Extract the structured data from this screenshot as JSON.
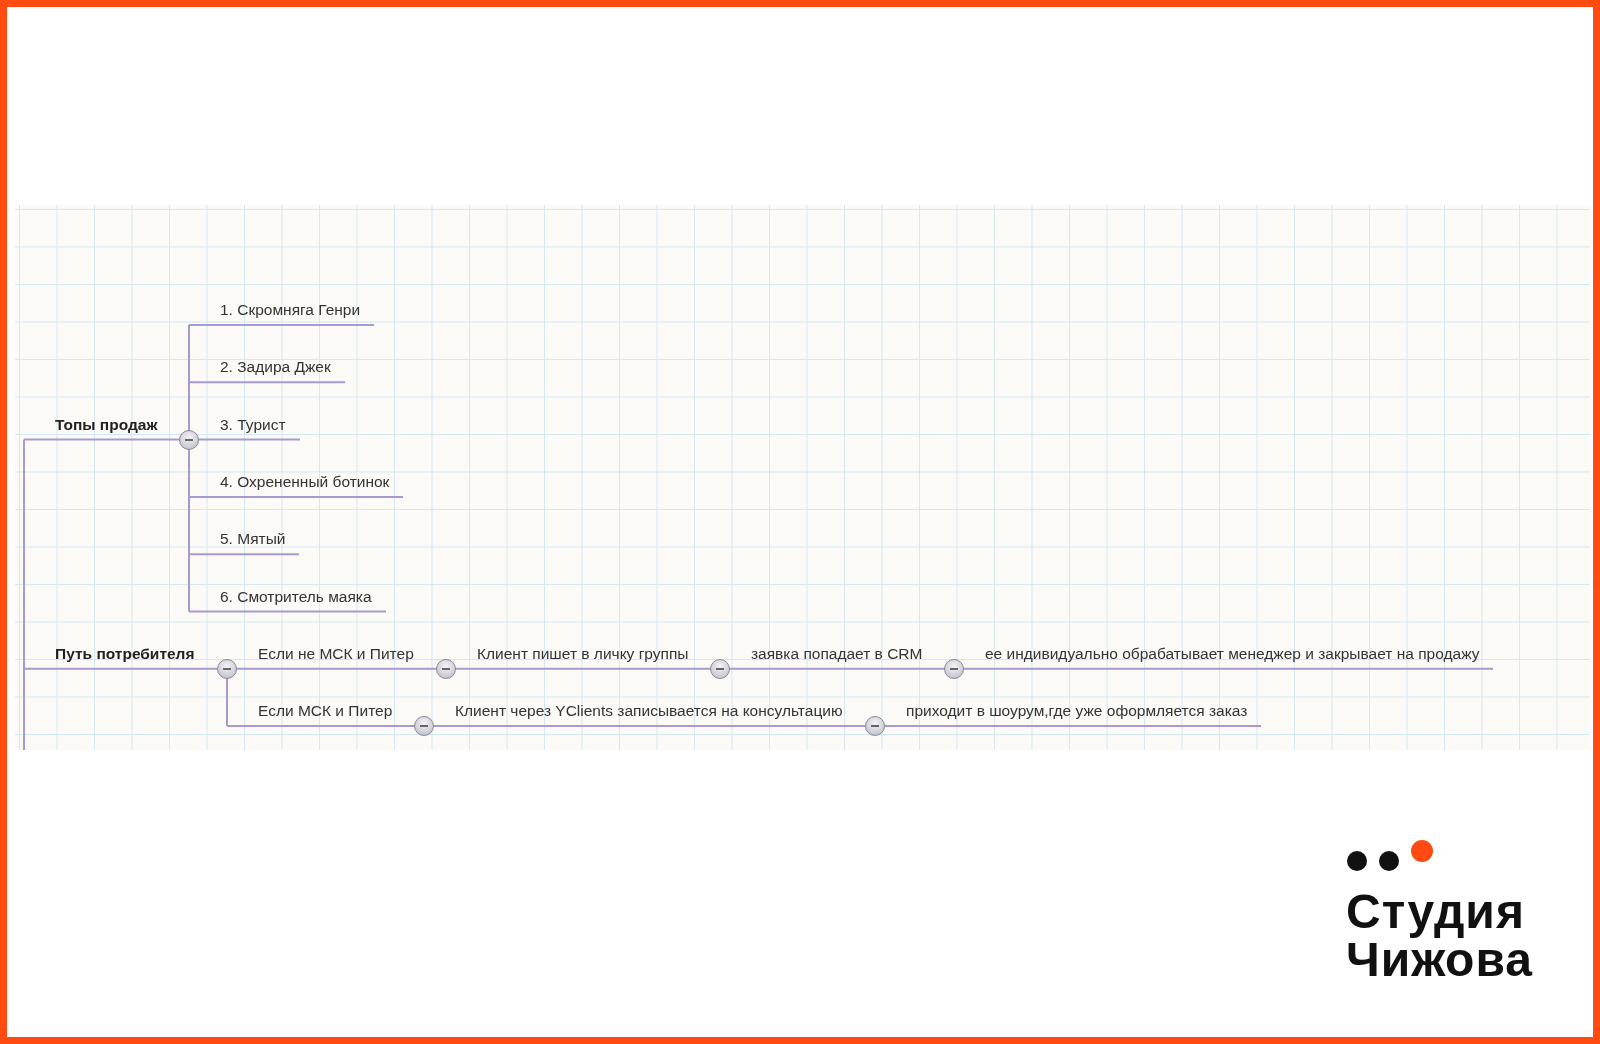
{
  "mindmap": {
    "branches": [
      {
        "text": "Топы продаж",
        "expanded": true,
        "children": [
          {
            "text": "1. Скромняга Генри"
          },
          {
            "text": "2. Задира Джек"
          },
          {
            "text": "3. Турист"
          },
          {
            "text": "4. Охрененный ботинок"
          },
          {
            "text": "5. Мятый"
          },
          {
            "text": "6. Смотритель маяка"
          }
        ]
      },
      {
        "text": "Путь потребителя",
        "expanded": true,
        "children": [
          {
            "text": "Если не МСК и Питер",
            "expanded": true,
            "children": [
              {
                "text": "Клиент пишет в личку группы",
                "expanded": true,
                "children": [
                  {
                    "text": "заявка попадает в CRM",
                    "expanded": true,
                    "children": [
                      {
                        "text": "ее индивидуально обрабатывает менеджер и закрывает на продажу"
                      }
                    ]
                  }
                ]
              }
            ]
          },
          {
            "text": "Если МСК и Питер",
            "expanded": true,
            "children": [
              {
                "text": "Клиент через YClients записывается на консультацию",
                "expanded": true,
                "children": [
                  {
                    "text": "приходит в шоурум,где уже оформляется заказ"
                  }
                ]
              }
            ]
          }
        ]
      }
    ]
  },
  "logo": {
    "line_1": "Студия",
    "line_2": "Чижова"
  }
}
